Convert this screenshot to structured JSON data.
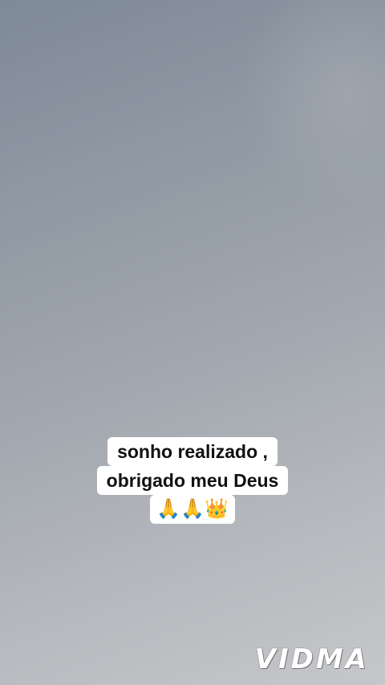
{
  "caption": {
    "line1": "sonho realizado ,",
    "line2": "obrigado meu Deus",
    "emojis": [
      "🙏",
      "🙏",
      "👑"
    ]
  },
  "watermark": {
    "text": "VIDMA"
  },
  "colors": {
    "caption_background": "#ffffff",
    "caption_text": "#111111",
    "sky_top": "#7f8a97",
    "sky_bottom": "#c6c7ca"
  }
}
